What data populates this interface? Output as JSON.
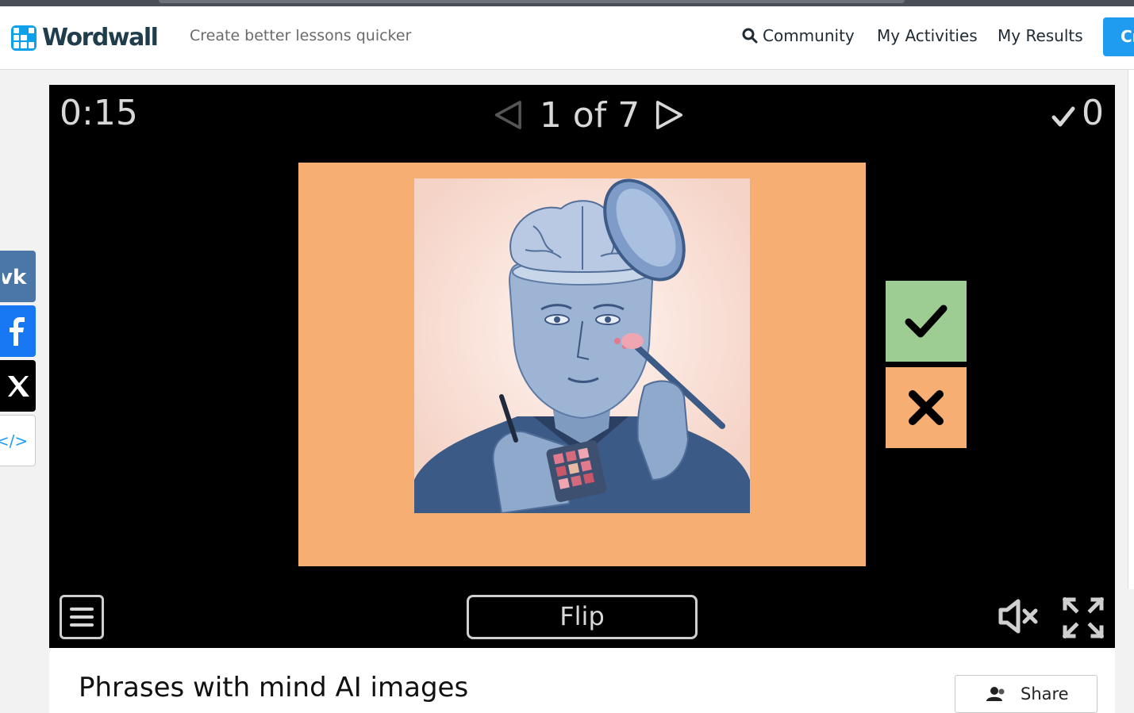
{
  "header": {
    "logo_text": "Wordwall",
    "tagline": "Create better lessons quicker",
    "nav": {
      "community": "Community",
      "my_activities": "My Activities",
      "my_results": "My Results"
    },
    "create_label": "Cr"
  },
  "social": {
    "vk_label": "vk",
    "embed_label": "</>"
  },
  "game": {
    "timer": "0:15",
    "pager": "1 of 7",
    "score": "0",
    "flip_label": "Flip"
  },
  "activity": {
    "title": "Phrases with mind AI images",
    "share_label": "Share"
  },
  "colors": {
    "brand": "#0ea0e8",
    "card_bg": "#f7ae72",
    "correct_bg": "#9ecd94",
    "create_btn": "#1f9cf0"
  }
}
